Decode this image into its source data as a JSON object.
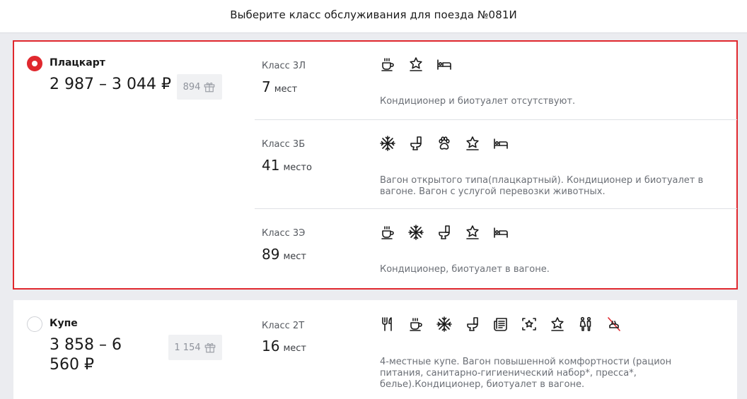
{
  "header": {
    "title": "Выберите класс обслуживания для поезда №081И"
  },
  "cars": [
    {
      "name": "Плацкарт",
      "price": "2 987 – 3 044 ₽",
      "bonus": "894",
      "selected": true,
      "classes": [
        {
          "name": "Класс 3Л",
          "seats": "7",
          "seats_word": "мест",
          "icons": [
            "coffee-icon",
            "star-service-icon",
            "bed-icon"
          ],
          "description": "Кондиционер и биотуалет отсутствуют."
        },
        {
          "name": "Класс 3Б",
          "seats": "41",
          "seats_word": "место",
          "icons": [
            "snowflake-icon",
            "toilet-icon",
            "paw-icon",
            "star-service-icon",
            "bed-icon"
          ],
          "description": "Вагон открытого типа(плацкартный). Кондиционер и биотуалет в вагоне. Вагон с услугой перевозки животных."
        },
        {
          "name": "Класс 3Э",
          "seats": "89",
          "seats_word": "мест",
          "icons": [
            "coffee-icon",
            "snowflake-icon",
            "toilet-icon",
            "star-service-icon",
            "bed-icon"
          ],
          "description": "Кондиционер, биотуалет в вагоне."
        }
      ]
    },
    {
      "name": "Купе",
      "price": "3 858 – 6 560 ₽",
      "bonus": "1 154",
      "selected": false,
      "classes": [
        {
          "name": "Класс 2Т",
          "seats": "16",
          "seats_word": "мест",
          "icons": [
            "food-icon",
            "coffee-icon",
            "snowflake-icon",
            "toilet-icon",
            "newspaper-icon",
            "hygiene-kit-icon",
            "star-service-icon",
            "restroom-icon",
            "no-pets-icon"
          ],
          "description": "4-местные купе. Вагон повышенной комфортности (рацион питания, санитарно-гигиенический набор*, пресса*, белье).Кондиционер, биотуалет в вагоне."
        }
      ]
    }
  ],
  "colors": {
    "accent": "#e0282e",
    "background": "#ebecf0"
  }
}
